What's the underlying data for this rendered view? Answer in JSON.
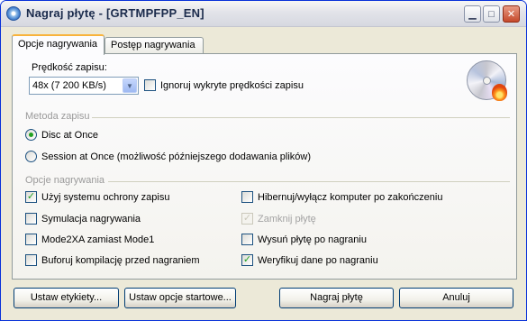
{
  "window": {
    "title": "Nagraj płytę - [GRTMPFPP_EN]"
  },
  "tabs": [
    {
      "label": "Opcje nagrywania",
      "active": true
    },
    {
      "label": "Postęp nagrywania",
      "active": false
    }
  ],
  "speed": {
    "label": "Prędkość zapisu:",
    "selected": "48x (7 200 KB/s)",
    "ignore_label": "Ignoruj wykryte prędkości zapisu",
    "ignore_checked": false
  },
  "write_method": {
    "group_label": "Metoda zapisu",
    "options": [
      {
        "label": "Disc at Once",
        "selected": true
      },
      {
        "label": "Session at Once (możliwość późniejszego dodawania plików)",
        "selected": false
      }
    ]
  },
  "burn_options": {
    "group_label": "Opcje nagrywania",
    "left": [
      {
        "label": "Użyj systemu ochrony zapisu",
        "checked": true
      },
      {
        "label": "Symulacja nagrywania",
        "checked": false
      },
      {
        "label": "Mode2XA zamiast Mode1",
        "checked": false
      },
      {
        "label": "Buforuj kompilację przed nagraniem",
        "checked": false
      }
    ],
    "right": [
      {
        "label": "Hibernuj/wyłącz komputer po zakończeniu",
        "checked": false
      },
      {
        "label": "Zamknij płytę",
        "checked": true,
        "disabled": true
      },
      {
        "label": "Wysuń płytę po nagraniu",
        "checked": false
      },
      {
        "label": "Weryfikuj dane po nagraniu",
        "checked": true
      }
    ]
  },
  "buttons": {
    "labels": "Ustaw etykiety...",
    "startup": "Ustaw opcje startowe...",
    "burn": "Nagraj płytę",
    "cancel": "Anuluj"
  },
  "icons": {
    "app": "disc-burn-icon",
    "panel": "cd-flame-icon",
    "minimize": "minimize-icon",
    "maximize": "maximize-icon",
    "close": "close-icon"
  },
  "colors": {
    "window_bg": "#ece9d8",
    "active_tab_accent": "#f8b33c",
    "check_mark": "#21a121",
    "close_button": "#c5492b"
  }
}
